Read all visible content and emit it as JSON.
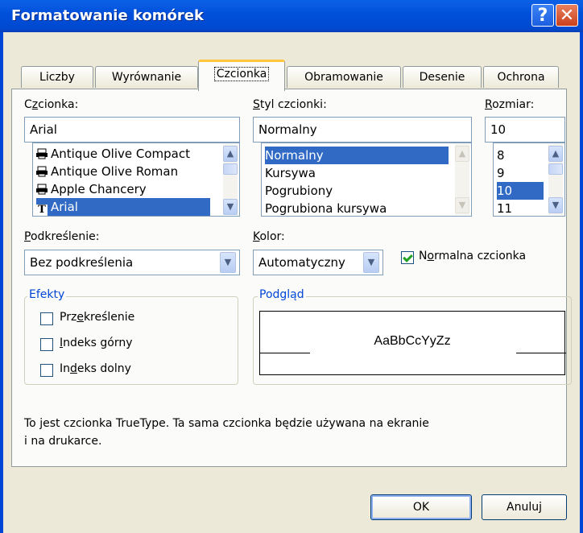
{
  "window": {
    "title": "Formatowanie komórek",
    "help_glyph": "?",
    "close_glyph": "✕"
  },
  "tabs": [
    {
      "label": "Liczby"
    },
    {
      "label": "Wyrównanie"
    },
    {
      "label": "Czcionka"
    },
    {
      "label": "Obramowanie"
    },
    {
      "label": "Desenie"
    },
    {
      "label": "Ochrona"
    }
  ],
  "font": {
    "label_pre": "C",
    "label_u": "z",
    "label_post": "cionka:",
    "value": "Arial",
    "items": [
      {
        "label": "Antique Olive Compact",
        "icon": "printer-font-icon"
      },
      {
        "label": "Antique Olive Roman",
        "icon": "printer-font-icon"
      },
      {
        "label": "Apple Chancery",
        "icon": "printer-font-icon"
      },
      {
        "label": "Arial",
        "icon": "truetype-font-icon",
        "selected": true
      }
    ]
  },
  "style": {
    "label_u": "S",
    "label_post": "tyl czcionki:",
    "value": "Normalny",
    "items": [
      {
        "label": "Normalny",
        "selected": true
      },
      {
        "label": "Kursywa"
      },
      {
        "label": "Pogrubiony"
      },
      {
        "label": "Pogrubiona kursywa"
      }
    ]
  },
  "size": {
    "label_u": "R",
    "label_post": "ozmiar:",
    "value": "10",
    "items": [
      {
        "label": "8"
      },
      {
        "label": "9"
      },
      {
        "label": "10",
        "selected": true
      },
      {
        "label": "11"
      }
    ]
  },
  "underline": {
    "label_u": "P",
    "label_post": "odkreślenie:",
    "value": "Bez podkreślenia"
  },
  "color": {
    "label_u": "K",
    "label_post": "olor:",
    "value": "Automatyczny"
  },
  "normal_font": {
    "label_pre": "N",
    "label_u": "o",
    "label_post": "rmalna czcionka",
    "checked": true
  },
  "effects": {
    "label": "Efekty",
    "items": [
      {
        "pre": "Prz",
        "u": "e",
        "post": "kreślenie",
        "checked": false
      },
      {
        "pre": "",
        "u": "I",
        "post": "ndeks górny",
        "checked": false
      },
      {
        "pre": "In",
        "u": "d",
        "post": "eks dolny",
        "checked": false
      }
    ]
  },
  "preview": {
    "label": "Podgląd",
    "sample": "AaBbCcYyZz"
  },
  "info_line1": "To jest czcionka TrueType. Ta sama czcionka będzie używana na ekranie",
  "info_line2": "i na drukarce.",
  "buttons": {
    "ok": "OK",
    "cancel": "Anuluj"
  }
}
